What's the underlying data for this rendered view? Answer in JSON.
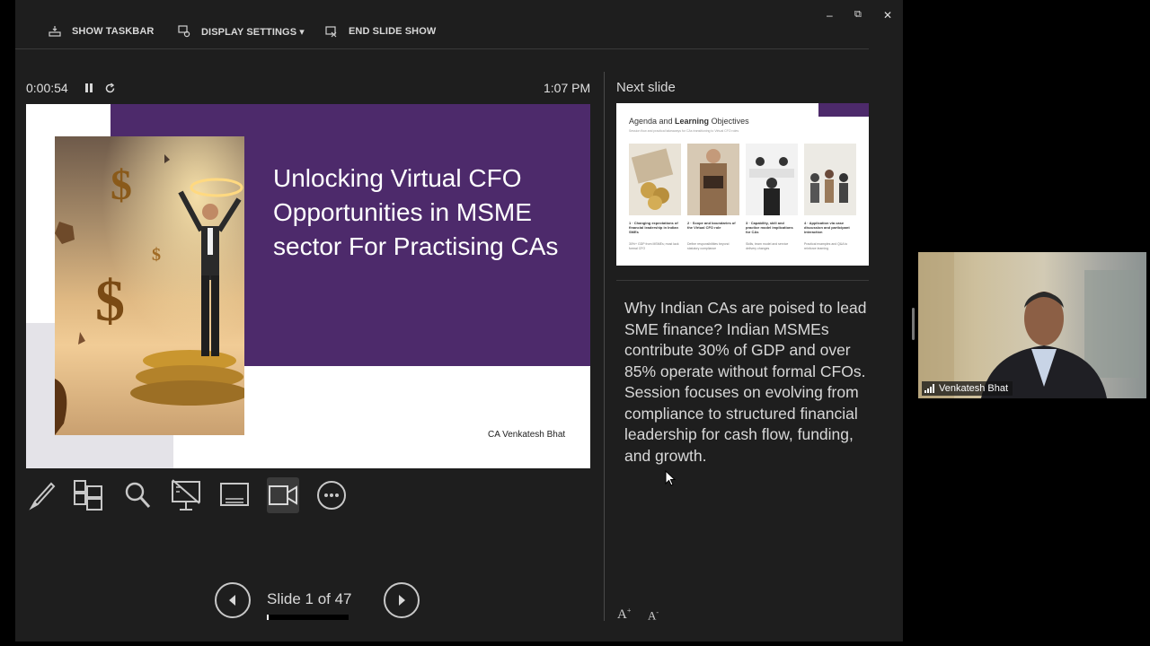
{
  "toolbar": {
    "show_taskbar": "SHOW TASKBAR",
    "display_settings": "DISPLAY SETTINGS ▾",
    "end_slide_show": "END SLIDE SHOW",
    "minimize": "–",
    "restore": "⧉",
    "close": "✕"
  },
  "timer": {
    "elapsed": "0:00:54",
    "clock": "1:07 PM"
  },
  "current_slide": {
    "title": "Unlocking Virtual CFO Opportunities in MSME sector For Practising CAs",
    "author": "CA Venkatesh Bhat",
    "dollar_sign": "$"
  },
  "tools": [
    "pen-tool",
    "see-all-slides",
    "zoom-into-slide",
    "pointer-options",
    "subtitles",
    "camera-toggle",
    "more-options"
  ],
  "navigation": {
    "slide_label": "Slide 1 of 47",
    "current": 1,
    "total": 47
  },
  "next_slide": {
    "label": "Next slide",
    "title_prefix": "Agenda and ",
    "title_bold": "Learning",
    "title_suffix": " Objectives",
    "subtitle": "Session flow and practical takeaways for CAs transitioning to Virtual CFO roles",
    "items": [
      {
        "heading": "1 · Changing expectations of financial leadership in Indian SMEs",
        "text": "30%+ GDP from MSMEs; most lack formal CFO"
      },
      {
        "heading": "2 · Scope and boundaries of the Virtual CFO role",
        "text": "Define responsibilities beyond statutory compliance"
      },
      {
        "heading": "3 · Capability, skill and practice model implications for CAs",
        "text": "Skills, team model and service delivery changes"
      },
      {
        "heading": "4 · Application via case discussion and participant interaction",
        "text": "Practical examples and Q&A to reinforce learning"
      }
    ]
  },
  "notes": "Why Indian CAs are poised to lead SME finance? Indian MSMEs contribute 30% of GDP and over 85% operate without formal CFOs. Session focuses on evolving from compliance to structured financial leadership for cash flow, funding, and growth.",
  "font_controls": {
    "increase": "A",
    "decrease": "A"
  },
  "video": {
    "participant": "Venkatesh Bhat"
  },
  "colors": {
    "slide_purple": "#4d2a6b",
    "background": "#1e1e1e"
  }
}
